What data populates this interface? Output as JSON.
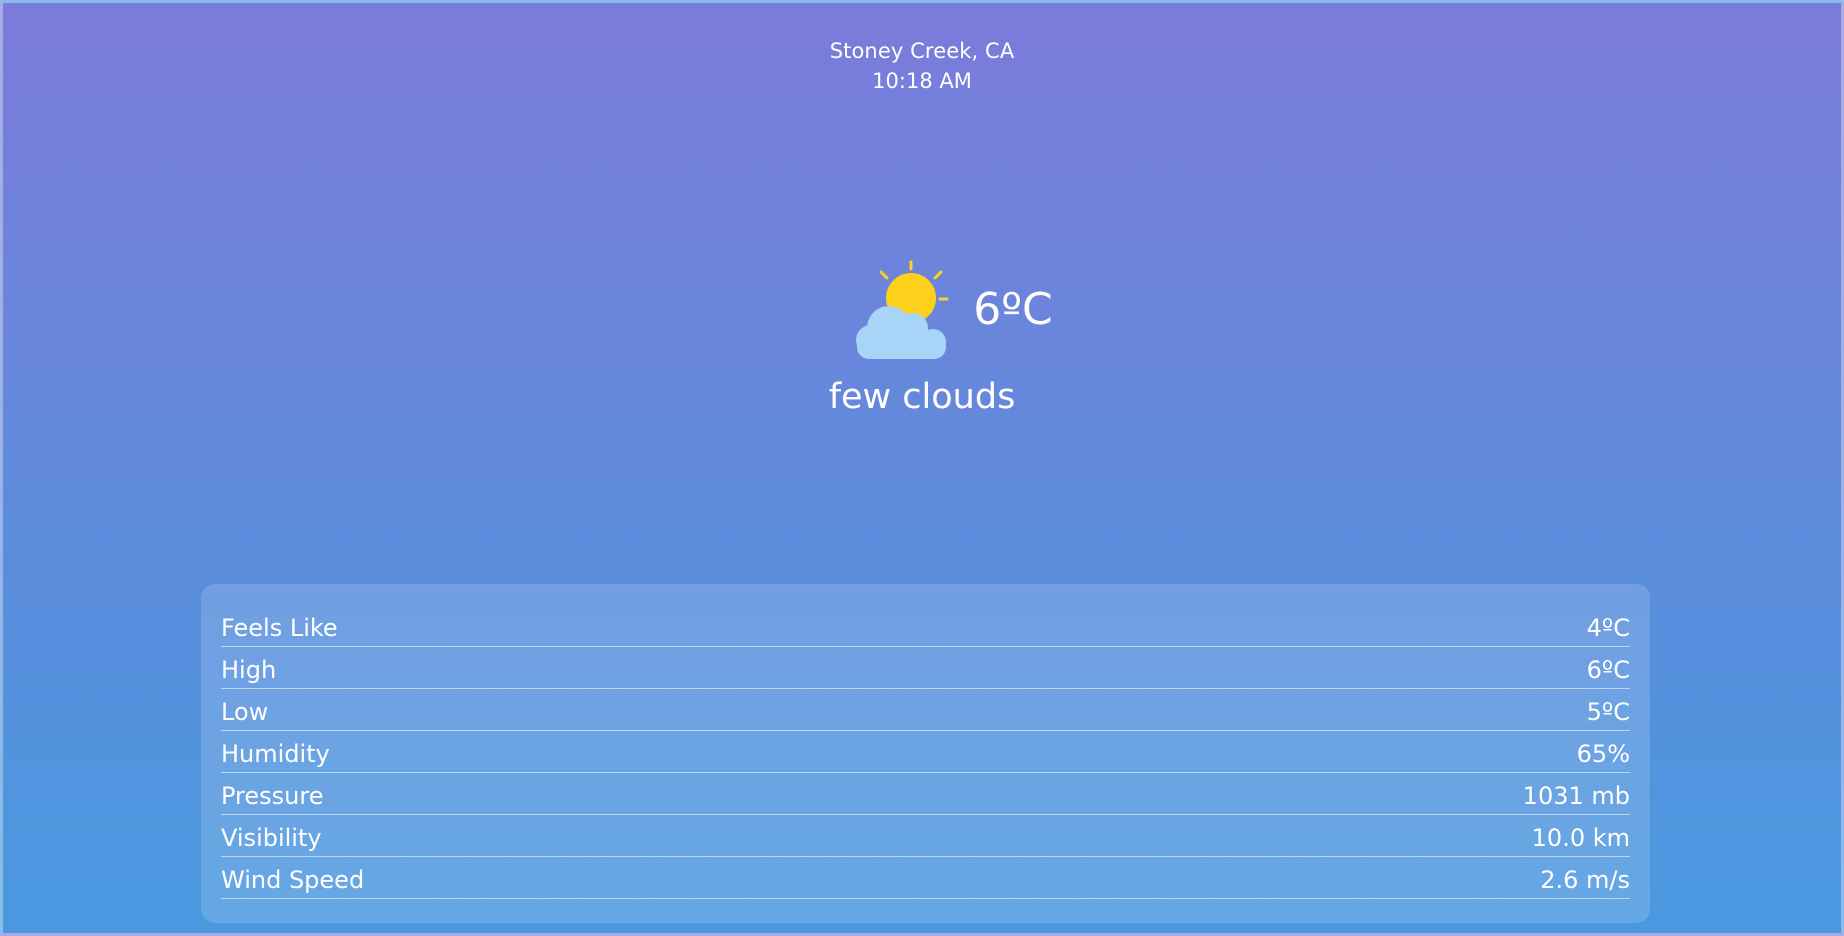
{
  "header": {
    "location": "Stoney Creek, CA",
    "time": "10:18 AM"
  },
  "current": {
    "icon": "partly-cloudy-icon",
    "temperature": "6ºC",
    "description": "few clouds"
  },
  "details": [
    {
      "label": "Feels Like",
      "value": "4ºC"
    },
    {
      "label": "High",
      "value": "6ºC"
    },
    {
      "label": "Low",
      "value": "5ºC"
    },
    {
      "label": "Humidity",
      "value": "65%"
    },
    {
      "label": "Pressure",
      "value": "1031 mb"
    },
    {
      "label": "Visibility",
      "value": "10.0 km"
    },
    {
      "label": "Wind Speed",
      "value": "2.6 m/s"
    }
  ],
  "colors": {
    "gradient_top": "#7b7bdb",
    "gradient_bottom": "#4a99e0",
    "sun": "#fdd11b",
    "cloud": "#a8d4f7"
  }
}
